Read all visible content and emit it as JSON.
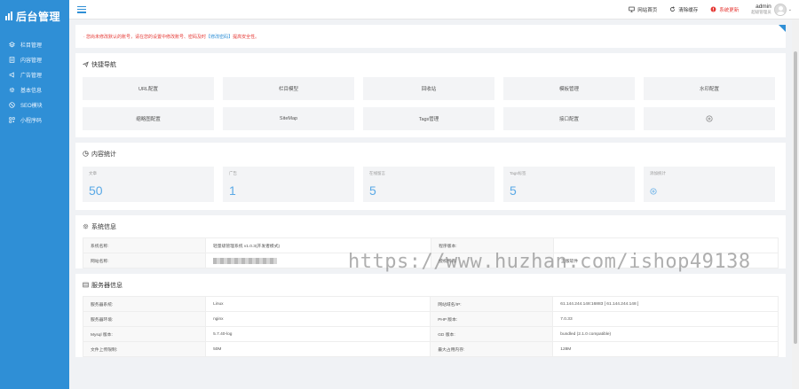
{
  "sidebar": {
    "logo": "后台管理",
    "items": [
      {
        "label": "栏目管理",
        "icon": "layers-icon"
      },
      {
        "label": "内容管理",
        "icon": "file-icon"
      },
      {
        "label": "广告管理",
        "icon": "megaphone-icon"
      },
      {
        "label": "基本信息",
        "icon": "gear-icon"
      },
      {
        "label": "SEO模块",
        "icon": "target-icon"
      },
      {
        "label": "小程序码",
        "icon": "qrcode-icon"
      }
    ]
  },
  "header": {
    "links": [
      {
        "label": "网站首页",
        "icon": "monitor-icon"
      },
      {
        "label": "清除缓存",
        "icon": "refresh-icon"
      },
      {
        "label": "系统更新",
        "icon": "alert-icon"
      }
    ],
    "admin_name": "admin",
    "admin_role": "超级管理员"
  },
  "notice": {
    "prefix": "· 您尚未修改默认的账号，请在您的设置中修改账号、密码及时 ",
    "link": "【修改密码】",
    "suffix": "提高安全性。"
  },
  "quick_nav": {
    "title": "快捷导航",
    "items": [
      "URL配置",
      "栏目模型",
      "回收站",
      "模板管理",
      "水印配置",
      "缩略图配置",
      "SiteMap",
      "Tags管理",
      "接口配置"
    ],
    "add_icon": "plus-circle-icon"
  },
  "stats": {
    "title": "内容统计",
    "items": [
      {
        "label": "文章",
        "value": "50"
      },
      {
        "label": "广告",
        "value": "1"
      },
      {
        "label": "在线留言",
        "value": "5"
      },
      {
        "label": "Tags标签",
        "value": "5"
      },
      {
        "label": "添加统计",
        "value": ""
      }
    ]
  },
  "system_info": {
    "title": "系统信息",
    "rows": [
      {
        "k1": "系统名称:",
        "v1": "轻量级管理系统 v1.0.3(开发者模式)",
        "k2": "程序版本:",
        "v2": ""
      },
      {
        "k1": "网站名称:",
        "v1": "",
        "k2": "授权所有:",
        "v2": "正版软件"
      }
    ]
  },
  "server_info": {
    "title": "服务器信息",
    "rows": [
      {
        "k1": "服务器系统:",
        "v1": "Linux",
        "k2": "网站域名/IP:",
        "v2": "61.144.244.148:16883 [ 61.144.244.148 ]"
      },
      {
        "k1": "服务器环境:",
        "v1": "nginx",
        "k2": "PHP 版本:",
        "v2": "7.0.33"
      },
      {
        "k1": "Mysql 版本:",
        "v1": "5.7.40-log",
        "k2": "GD 版本:",
        "v2": "bundled (2.1.0 compatible)"
      },
      {
        "k1": "文件上传限制:",
        "v1": "50M",
        "k2": "最大占用内存:",
        "v2": "128M"
      }
    ]
  },
  "watermark": "https://www.huzhan.com/ishop49138"
}
